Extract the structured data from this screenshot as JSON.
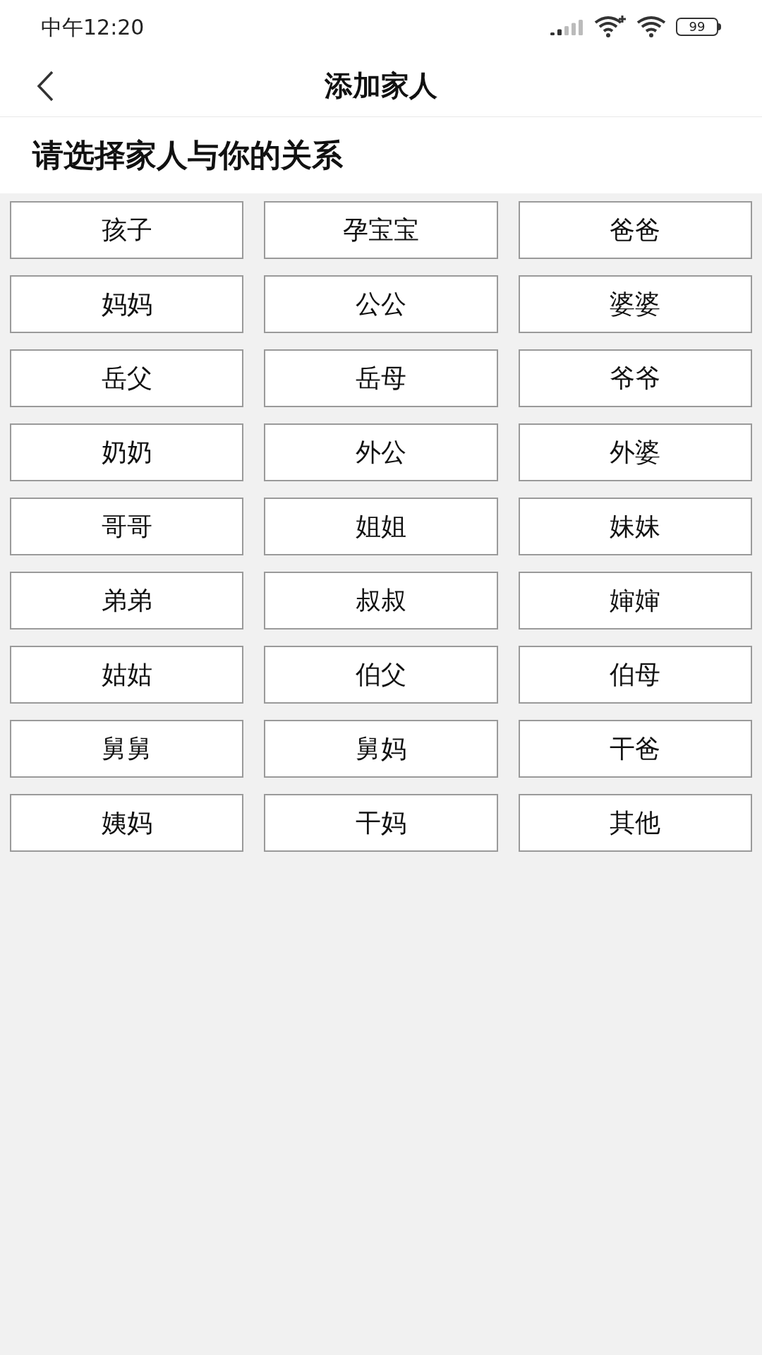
{
  "status_bar": {
    "time": "中午12:20",
    "battery": "99"
  },
  "header": {
    "title": "添加家人"
  },
  "prompt": "请选择家人与你的关系",
  "options": [
    {
      "label": "孩子"
    },
    {
      "label": "孕宝宝"
    },
    {
      "label": "爸爸"
    },
    {
      "label": "妈妈"
    },
    {
      "label": "公公"
    },
    {
      "label": "婆婆"
    },
    {
      "label": "岳父"
    },
    {
      "label": "岳母"
    },
    {
      "label": "爷爷"
    },
    {
      "label": "奶奶"
    },
    {
      "label": "外公"
    },
    {
      "label": "外婆"
    },
    {
      "label": "哥哥"
    },
    {
      "label": "姐姐"
    },
    {
      "label": "妹妹"
    },
    {
      "label": "弟弟"
    },
    {
      "label": "叔叔"
    },
    {
      "label": "婶婶"
    },
    {
      "label": "姑姑"
    },
    {
      "label": "伯父"
    },
    {
      "label": "伯母"
    },
    {
      "label": "舅舅"
    },
    {
      "label": "舅妈"
    },
    {
      "label": "干爸"
    },
    {
      "label": "姨妈"
    },
    {
      "label": "干妈"
    },
    {
      "label": "其他"
    }
  ]
}
